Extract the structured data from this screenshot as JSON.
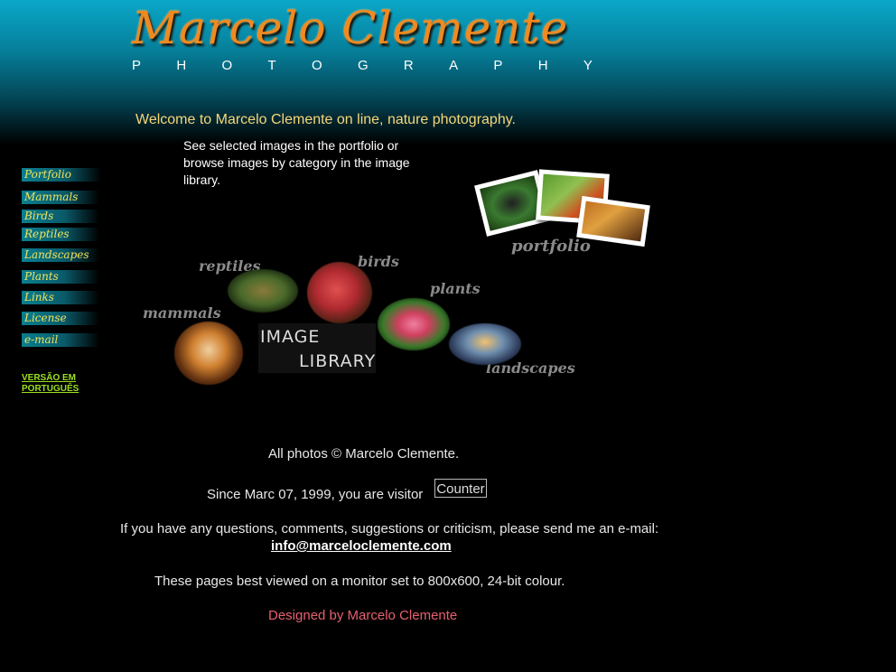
{
  "header": {
    "title": "Marcelo Clemente",
    "subtitle_letters": [
      "P",
      "H",
      "O",
      "T",
      "O",
      "G",
      "R",
      "A",
      "P",
      "H",
      "Y"
    ]
  },
  "welcome": "Welcome to Marcelo Clemente on line, nature photography.",
  "intro": "See selected images in the portfolio or browse images by category in the image library.",
  "nav": {
    "items": [
      {
        "label": "Portfolio"
      },
      {
        "label": "Mammals"
      },
      {
        "label": "Birds"
      },
      {
        "label": "Reptiles"
      },
      {
        "label": "Landscapes"
      },
      {
        "label": "Plants"
      },
      {
        "label": "Links"
      },
      {
        "label": "License"
      },
      {
        "label": "e-mail"
      }
    ],
    "portuguese_link": "VERSÃO EM PORTUGUÊS"
  },
  "library": {
    "labels": {
      "reptiles": "reptiles",
      "birds": "birds",
      "plants": "plants",
      "mammals": "mammals",
      "landscapes": "landscapes"
    },
    "image_library_line1": "IMAGE",
    "image_library_line2": "LIBRARY"
  },
  "portfolio_label": "portfolio",
  "footer": {
    "copyright": "All photos © Marcelo Clemente.",
    "visitor_text": "Since Marc 07, 1999, you are visitor",
    "counter": "Counter",
    "contact_text": "If you have any questions, comments, suggestions or criticism, please send me an e-mail:",
    "email": "info@marceloclemente.com",
    "monitor_note": "These pages best viewed on a monitor set to 800x600, 24-bit colour.",
    "designer": "Designed by Marcelo Clemente"
  },
  "colors": {
    "title": "#f08a20",
    "welcome": "#f5d778",
    "nav_text": "#f2e35a",
    "portuguese_link": "#9be020",
    "designer": "#e86070"
  }
}
